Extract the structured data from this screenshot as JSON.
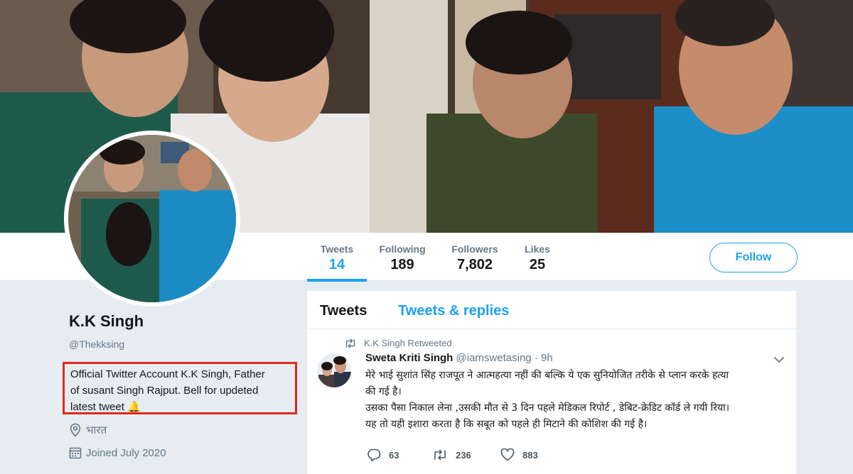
{
  "stats": [
    {
      "label": "Tweets",
      "value": "14",
      "active": true
    },
    {
      "label": "Following",
      "value": "189"
    },
    {
      "label": "Followers",
      "value": "7,802"
    },
    {
      "label": "Likes",
      "value": "25"
    }
  ],
  "follow_label": "Follow",
  "profile": {
    "name": "K.K Singh",
    "handle": "@Thekksing",
    "bio_line1": "Official Twitter Account K.K Singh, Father",
    "bio_line2": "of susant Singh Rajput. Bell for updeted",
    "bio_line3": "latest tweet",
    "bio_emoji": "🔔",
    "location": "भारत",
    "joined": "Joined July 2020"
  },
  "tabs": {
    "tweets": "Tweets",
    "tweets_replies": "Tweets & replies"
  },
  "tweet": {
    "retweet_label": "K.K Singh Retweeted",
    "author_name": "Sweta Kriti Singh",
    "author_handle": "@iamswetasing",
    "separator": "·",
    "time": "9h",
    "text_line1": "मेरे भाई सुशांत सिंह राजपूत ने आत्महत्या नहीं की बल्कि ये एक सुनियोजित तरीके से प्लान करके हत्या",
    "text_line2": "की गई है।",
    "text_line3": "उसका पैसा निकाल लेना ,उसकी मौत से 3 दिन पहले मेडिकल रिपोर्ट , डेबिट-क्रेडिट कॉर्ड ले गयी रिया।",
    "text_line4": "यह तो यही इशारा करता है कि सबूत को पहले ही मिटाने की कोशिश की गई है।",
    "replies": "63",
    "retweets": "236",
    "likes": "883"
  },
  "colors": {
    "accent": "#1da1f2",
    "highlight_box": "#e0281f",
    "background": "#e6ecf0"
  },
  "icons": {
    "location": "location-pin-icon",
    "joined": "calendar-icon",
    "retweet": "retweet-icon",
    "reply": "reply-icon",
    "like": "heart-icon",
    "caret": "chevron-down-icon"
  }
}
